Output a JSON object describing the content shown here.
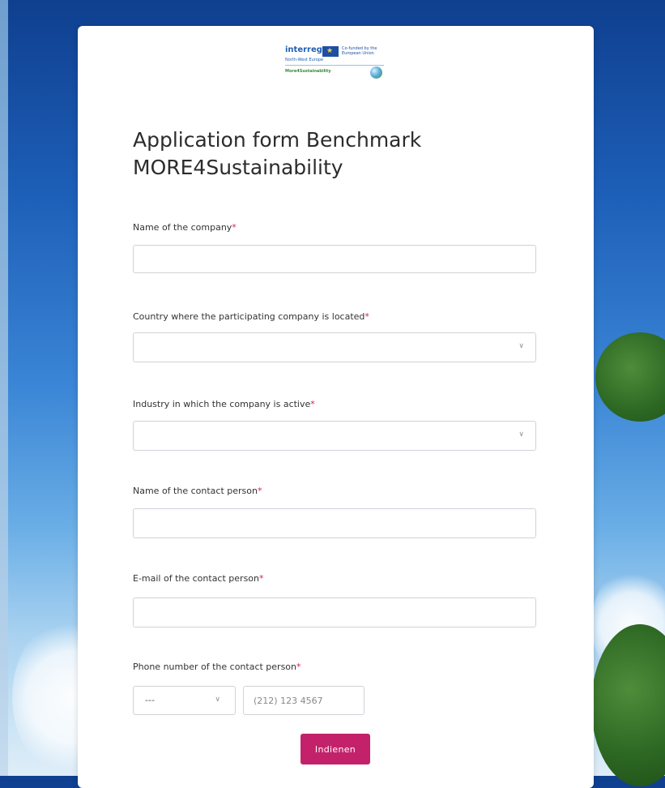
{
  "logo": {
    "brand": "interreg",
    "cofund": "Co-funded by the European Union",
    "region": "North-West Europe",
    "project": "More4Sustainability"
  },
  "form": {
    "title": "Application form Benchmark MORE4Sustainability",
    "required_marker": "*",
    "fields": {
      "company_name": {
        "label": "Name of the company",
        "value": ""
      },
      "country": {
        "label": "Country where the participating company is located",
        "value": ""
      },
      "industry": {
        "label": "Industry in which the company is active",
        "value": ""
      },
      "contact_name": {
        "label": "Name of the contact person",
        "value": ""
      },
      "contact_email": {
        "label": "E-mail of the contact person",
        "value": ""
      },
      "contact_phone": {
        "label": "Phone number of the contact person",
        "country_value": "---",
        "placeholder": "(212) 123 4567"
      }
    },
    "submit_label": "Indienen"
  },
  "colors": {
    "accent": "#c3226a",
    "required": "#d2254a"
  }
}
